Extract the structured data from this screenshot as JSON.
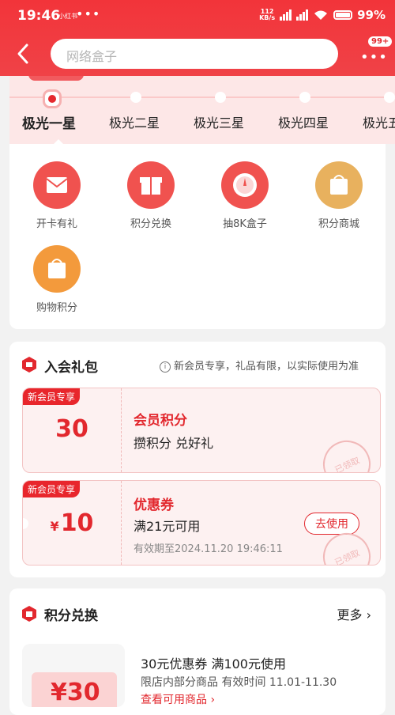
{
  "status_bar": {
    "time": "19:46",
    "chip": "小红书",
    "dots": "•••",
    "net_speed_top": "112",
    "net_speed_bottom": "KB/s",
    "battery": "99%"
  },
  "header": {
    "search_placeholder": "网络盒子",
    "badge": "99+",
    "more_dots": "•••"
  },
  "levels": [
    {
      "label": "极光一星",
      "active": true
    },
    {
      "label": "极光二星",
      "active": false
    },
    {
      "label": "极光三星",
      "active": false
    },
    {
      "label": "极光四星",
      "active": false
    },
    {
      "label": "极光五星",
      "active": false
    }
  ],
  "benefits": [
    {
      "label": "开卡有礼",
      "icon": "envelope-icon"
    },
    {
      "label": "积分兑换",
      "icon": "gift-icon"
    },
    {
      "label": "抽8K盒子",
      "icon": "dial-icon"
    },
    {
      "label": "积分商城",
      "icon": "shopping-bag-icon"
    },
    {
      "label": "购物积分",
      "icon": "shopping-bag-icon"
    }
  ],
  "gift_pack": {
    "title": "入会礼包",
    "note": "新会员专享，礼品有限，以实际使用为准",
    "points_coupon": {
      "tag": "新会员专享",
      "amount": "30",
      "title": "会员积分",
      "desc": "攒积分 兑好礼",
      "stamp": "已领取"
    },
    "voucher_coupon": {
      "tag": "新会员专享",
      "currency": "¥",
      "amount": "10",
      "title": "优惠券",
      "desc": "满21元可用",
      "validity": "有效期至2024.11.20 19:46:11",
      "button": "去使用",
      "stamp": "已领取"
    }
  },
  "points_exchange": {
    "title": "积分兑换",
    "more": "更多 ›",
    "item": {
      "thumb_value": "¥30",
      "title": "30元优惠券 满100元使用",
      "subtitle": "限店内部分商品 有效时间 11.01-11.30",
      "link": "查看可用商品 ›"
    }
  },
  "colors": {
    "brand_red": "#e2282e",
    "header_red": "#f2343a",
    "level_bg": "#fde7e7",
    "coupon_bg": "#fdf1f1",
    "icon_red": "#f0524f",
    "icon_gold": "#e8b15e",
    "icon_orange": "#f39a3c"
  }
}
